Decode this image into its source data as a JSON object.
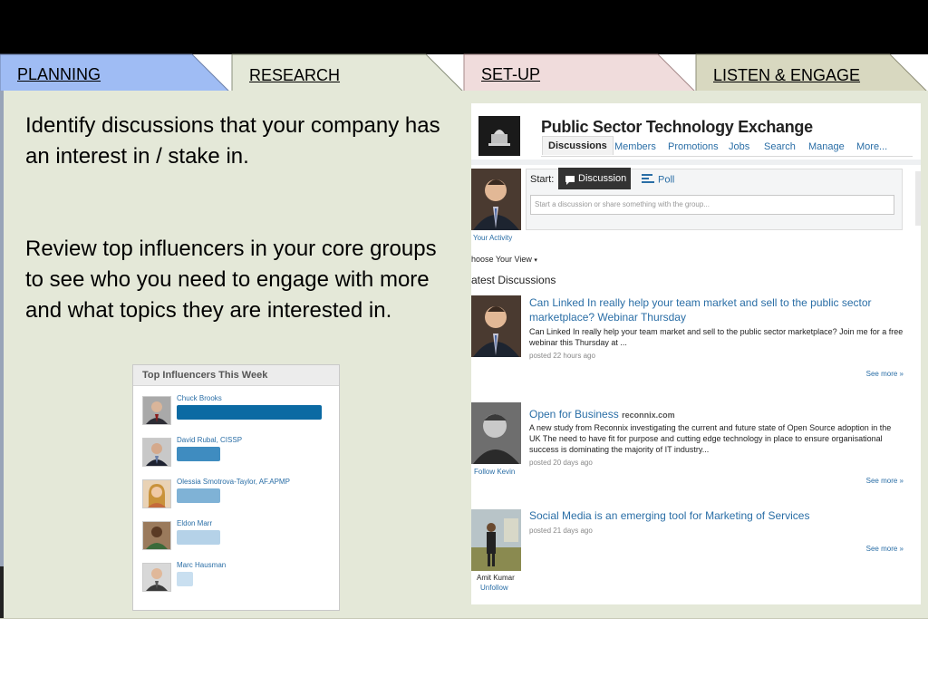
{
  "tabs": [
    {
      "label": "PLANNING",
      "color": "#9fbcf4"
    },
    {
      "label": "RESEARCH",
      "color": "#e4e8d8"
    },
    {
      "label": "SET-UP",
      "color": "#f0dcdc"
    },
    {
      "label": "LISTEN & ENGAGE",
      "color": "#d8d8c0"
    }
  ],
  "main": {
    "para1": "Identify discussions that your company has an interest in / stake in.",
    "para2": "Review top influencers in your core groups to see who you need to engage with more and what topics they are interested in."
  },
  "influencers": {
    "title": "Top Influencers This Week",
    "people": [
      {
        "name": "Chuck Brooks",
        "level": 1.0,
        "bar_color": "#0b6aa3"
      },
      {
        "name": "David Rubal, CISSP",
        "level": 0.3,
        "bar_color": "#3f8cc0"
      },
      {
        "name": "Olessia Smotrova-Taylor, AF.APMP",
        "level": 0.3,
        "bar_color": "#7fb2d6"
      },
      {
        "name": "Eldon Marr",
        "level": 0.3,
        "bar_color": "#b5d2e8"
      },
      {
        "name": "Marc Hausman",
        "level": 0.11,
        "bar_color": "#c9dff0"
      }
    ]
  },
  "group": {
    "title": "Public Sector Technology Exchange",
    "nav": [
      "Discussions",
      "Members",
      "Promotions",
      "Jobs",
      "Search",
      "Manage",
      "More..."
    ],
    "start_label": "Start:",
    "discussion_button": "Discussion",
    "poll_button": "Poll",
    "input_placeholder": "Start a discussion or share something with the group...",
    "your_activity": "Your Activity",
    "choose_view": "hoose Your View",
    "latest": "atest Discussions",
    "posts": [
      {
        "title": "Can Linked In really help your team market and sell to the public sector marketplace? Webinar Thursday",
        "body": "Can Linked In really help your team market and sell to the public sector marketplace? Join me for a free webinar this Thursday at ...",
        "meta": "posted 22 hours ago",
        "see_more": "See more »"
      },
      {
        "title": "Open for Business",
        "source": "reconnix.com",
        "body": "A new study from Reconnix investigating the current and future state of Open Source adoption in the UK The need to have fit for purpose and cutting edge technology in place to ensure organisational success is dominating the majority of IT industry...",
        "meta": "posted 20 days ago",
        "see_more": "See more »",
        "follow": "Follow Kevin"
      },
      {
        "title": "Social Media is an emerging tool for Marketing of Services",
        "body": "",
        "meta": "posted 21 days ago",
        "see_more": "See more »",
        "author": "Amit Kumar",
        "unfollow": "Unfollow"
      }
    ]
  }
}
